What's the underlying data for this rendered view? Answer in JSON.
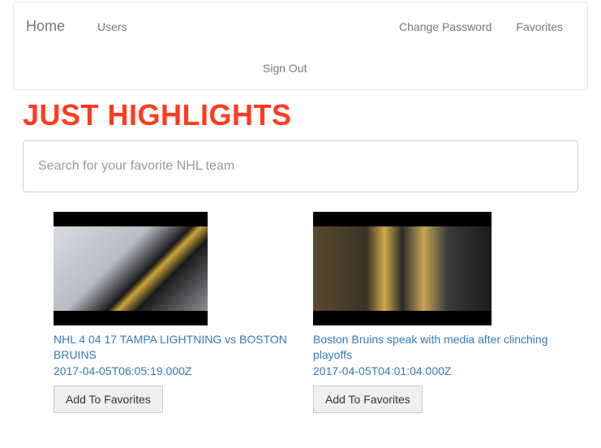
{
  "nav": {
    "brand": "Home",
    "left": [
      "Users"
    ],
    "right": [
      "Change Password",
      "Favorites"
    ],
    "row2": [
      "Sign Out"
    ]
  },
  "page": {
    "title": "JUST HIGHLIGHTS"
  },
  "search": {
    "placeholder": "Search for your favorite NHL team"
  },
  "cards": [
    {
      "title": "NHL 4 04 17 TAMPA LIGHTNING vs BOSTON BRUINS",
      "date": "2017-04-05T06:05:19.000Z",
      "button": "Add To Favorites"
    },
    {
      "title": "Boston Bruins speak with media after clinching playoffs",
      "date": "2017-04-05T04:01:04.000Z",
      "button": "Add To Favorites"
    }
  ],
  "colors": {
    "accent": "#ff3b1f",
    "link": "#337ab7"
  }
}
